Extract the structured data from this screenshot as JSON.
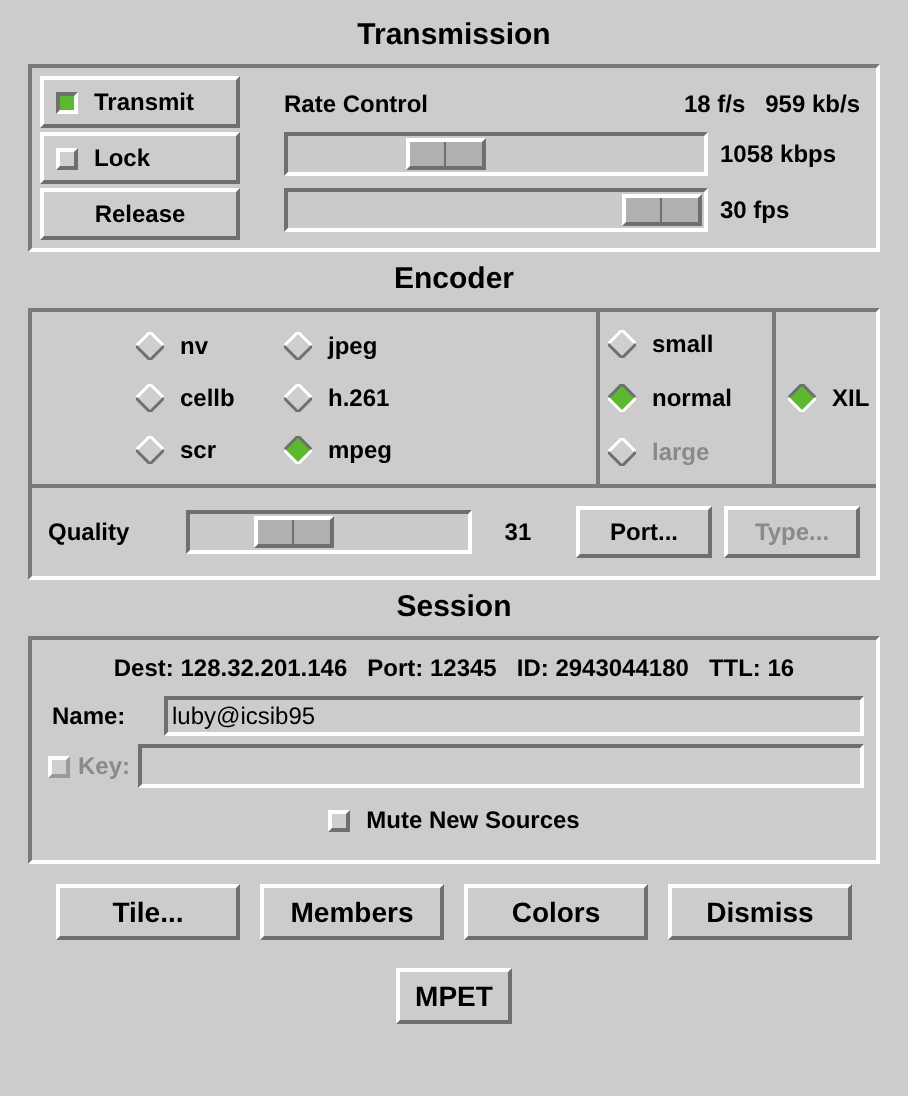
{
  "transmission": {
    "title": "Transmission",
    "controls": [
      {
        "kind": "toggle",
        "label": "Transmit",
        "checked": true
      },
      {
        "kind": "toggle",
        "label": "Lock",
        "checked": false
      },
      {
        "kind": "button",
        "label": "Release"
      }
    ],
    "rate_control": {
      "label": "Rate Control",
      "frame_rate": "18 f/s",
      "bit_rate": "959 kb/s"
    },
    "sliders": [
      {
        "reading": "1058 kbps"
      },
      {
        "reading": "30 fps"
      }
    ]
  },
  "encoder": {
    "title": "Encoder",
    "formats": [
      {
        "label": "nv",
        "selected": false
      },
      {
        "label": "cellb",
        "selected": false
      },
      {
        "label": "scr",
        "selected": false
      },
      {
        "label": "jpeg",
        "selected": false
      },
      {
        "label": "h.261",
        "selected": false
      },
      {
        "label": "mpeg",
        "selected": true
      }
    ],
    "sizes": [
      {
        "label": "small",
        "selected": false,
        "disabled": false
      },
      {
        "label": "normal",
        "selected": true,
        "disabled": false
      },
      {
        "label": "large",
        "selected": false,
        "disabled": true
      }
    ],
    "device": {
      "label": "XIL",
      "selected": true
    },
    "quality": {
      "label": "Quality",
      "reading": "31"
    },
    "buttons": [
      {
        "label": "Port...",
        "disabled": false
      },
      {
        "label": "Type...",
        "disabled": true
      }
    ]
  },
  "session": {
    "title": "Session",
    "info": [
      "Dest: 128.32.201.146",
      "Port: 12345",
      "ID: 2943044180",
      "TTL: 16"
    ],
    "name": {
      "label": "Name:",
      "value": "luby@icsib95"
    },
    "key": {
      "label": "Key:",
      "checked": false,
      "disabled": true
    },
    "mute": {
      "label": "Mute New Sources",
      "checked": false
    }
  },
  "buttons": [
    "Tile...",
    "Members",
    "Colors",
    "Dismiss"
  ],
  "bottom_button": "MPET"
}
